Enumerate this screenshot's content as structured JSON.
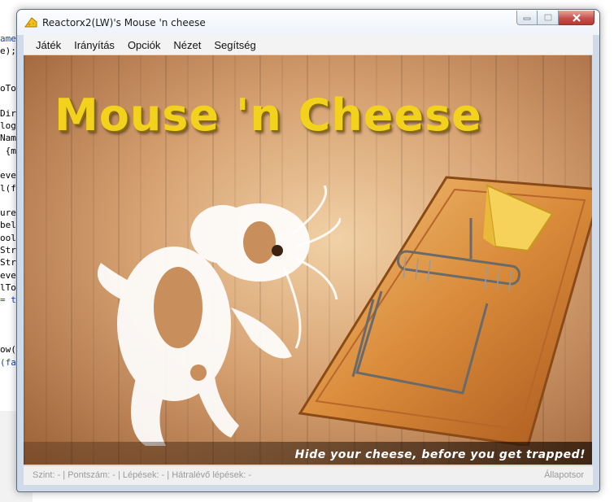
{
  "window": {
    "title": "Reactorx2(LW)'s Mouse 'n cheese",
    "icon": "cheese-icon"
  },
  "menu": [
    "Játék",
    "Irányítás",
    "Opciók",
    "Nézet",
    "Segítség"
  ],
  "game": {
    "logo": "Mouse 'n Cheese",
    "tagline": "Hide your cheese, before you get trapped!"
  },
  "status": {
    "left": "Szint: -  |  Pontszám: -  |  Lépések: -  |  Hátralévő lépések: -",
    "right": "Állapotsor"
  },
  "background_code": [
    "ame",
    "e);",
    "",
    "",
    "oTo",
    "",
    "Dir",
    "log",
    "Nam",
    " {m",
    "",
    "eve",
    "l(f",
    "",
    "ure",
    "bel",
    "ool",
    "Str",
    "Str",
    "eve",
    "lTo",
    "= t",
    "",
    "",
    "",
    "ow(",
    "(fa"
  ]
}
